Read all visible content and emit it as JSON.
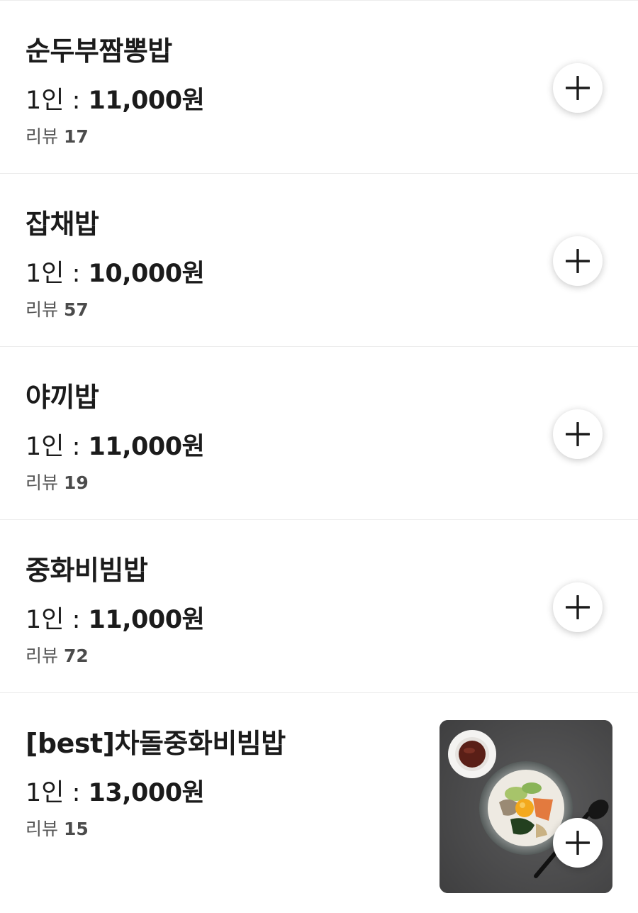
{
  "menu": {
    "items": [
      {
        "name": "순두부짬뽕밥",
        "price_prefix": "1인 : ",
        "price": "11,000원",
        "review_label": "리뷰",
        "review_count": "17"
      },
      {
        "name": "잡채밥",
        "price_prefix": "1인 : ",
        "price": "10,000원",
        "review_label": "리뷰",
        "review_count": "57"
      },
      {
        "name": "야끼밥",
        "price_prefix": "1인 : ",
        "price": "11,000원",
        "review_label": "리뷰",
        "review_count": "19"
      },
      {
        "name": "중화비빔밥",
        "price_prefix": "1인 : ",
        "price": "11,000원",
        "review_label": "리뷰",
        "review_count": "72"
      },
      {
        "name": "[best]차돌중화비빔밥",
        "price_prefix": "1인 : ",
        "price": "13,000원",
        "review_label": "리뷰",
        "review_count": "15",
        "has_photo": true
      }
    ]
  },
  "icons": {
    "add": "plus-icon"
  },
  "colors": {
    "text": "#1b1b1b",
    "subtext": "#555555",
    "divider": "#ececec",
    "button_bg": "#ffffff"
  }
}
